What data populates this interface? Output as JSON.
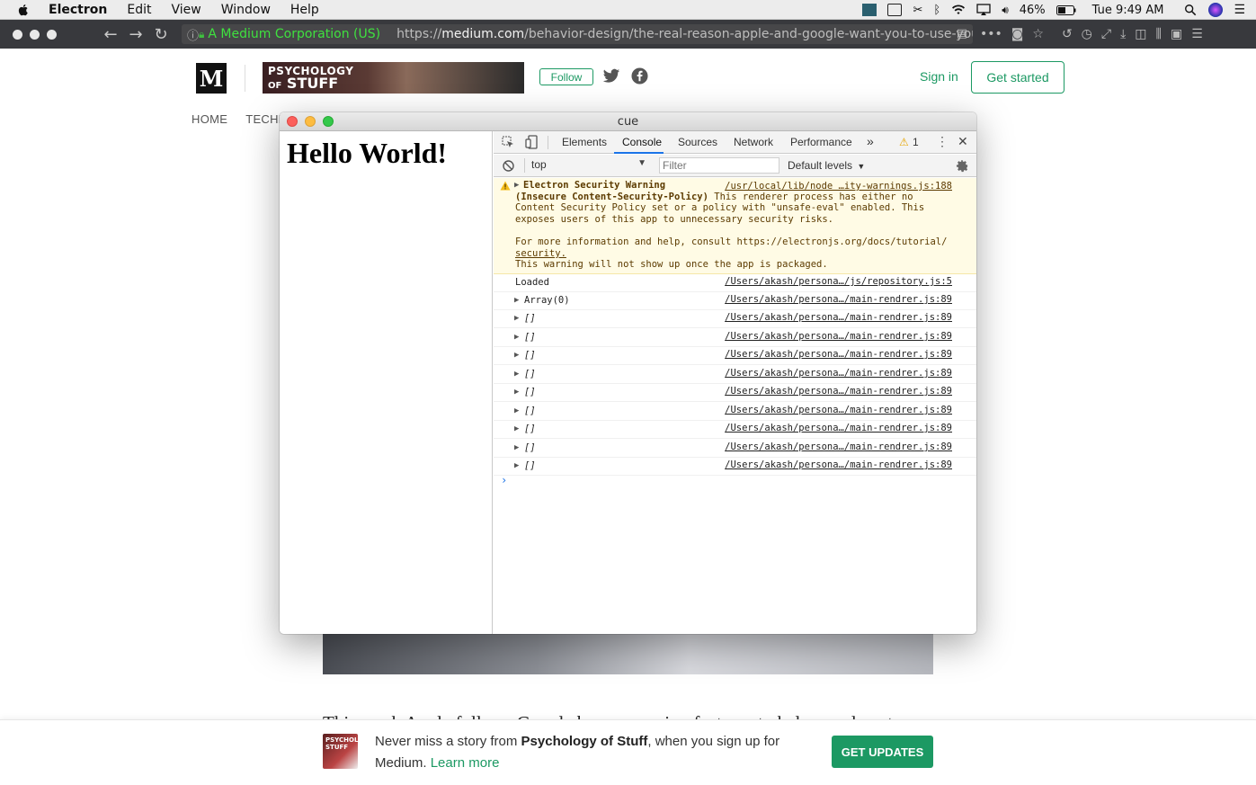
{
  "menubar": {
    "app_name": "Electron",
    "menus": [
      "Edit",
      "View",
      "Window",
      "Help"
    ],
    "battery": "46%",
    "clock": "Tue 9:49 AM"
  },
  "browser": {
    "org_label": "A Medium Corporation (US)",
    "url_prefix": "https://",
    "url_host": "medium.com",
    "url_path": "/behavior-design/the-real-reason-apple-and-google-want-you-to-use-you"
  },
  "medium": {
    "logo": "M",
    "banner_line1": "PSYCHOLOGY",
    "banner_of": "OF",
    "banner_line2": "STUFF",
    "follow": "Follow",
    "sign_in": "Sign in",
    "get_started": "Get started",
    "nav": [
      "HOME",
      "TECHN"
    ],
    "article_peek": "This week Apple follows Google by announcing features to help people cut"
  },
  "bottom_bar": {
    "thumb_text": "PSYCHOLOGY STUFF",
    "text_before": "Never miss a story from ",
    "publication": "Psychology of Stuff",
    "text_after": ", when you sign up for Medium.",
    "learn_more": "Learn more",
    "cta": "GET UPDATES"
  },
  "electron_window": {
    "title": "cue",
    "hello": "Hello World!"
  },
  "devtools": {
    "tabs": [
      "Elements",
      "Console",
      "Sources",
      "Network",
      "Performance"
    ],
    "more_tabs": "»",
    "warning_count": "1",
    "context": "top",
    "filter_placeholder": "Filter",
    "levels": "Default levels",
    "warning": {
      "line1": "Electron Security Warning",
      "line2_bold": "(Insecure Content-Security-Policy)",
      "line2_rest": " This renderer process has either no",
      "line3": "Content Security Policy set or a policy with \"unsafe-eval\" enabled. This",
      "line4": "exposes users of this app to unnecessary security risks.",
      "line5": "For more information and help, consult https://electronjs.org/docs/tutorial/",
      "line6": "security.",
      "line7": "This warning will not show up once the app is packaged.",
      "source": "/usr/local/lib/node …ity-warnings.js:188"
    },
    "logs": [
      {
        "message": "Loaded",
        "source": "/Users/akash/persona…/js/repository.js:5"
      },
      {
        "message": "Array(0)",
        "source": "/Users/akash/persona…/main-rendrer.js:89"
      },
      {
        "message": "[]",
        "source": "/Users/akash/persona…/main-rendrer.js:89"
      },
      {
        "message": "[]",
        "source": "/Users/akash/persona…/main-rendrer.js:89"
      },
      {
        "message": "[]",
        "source": "/Users/akash/persona…/main-rendrer.js:89"
      },
      {
        "message": "[]",
        "source": "/Users/akash/persona…/main-rendrer.js:89"
      },
      {
        "message": "[]",
        "source": "/Users/akash/persona…/main-rendrer.js:89"
      },
      {
        "message": "[]",
        "source": "/Users/akash/persona…/main-rendrer.js:89"
      },
      {
        "message": "[]",
        "source": "/Users/akash/persona…/main-rendrer.js:89"
      },
      {
        "message": "[]",
        "source": "/Users/akash/persona…/main-rendrer.js:89"
      },
      {
        "message": "[]",
        "source": "/Users/akash/persona…/main-rendrer.js:89"
      }
    ],
    "prompt": "›"
  }
}
